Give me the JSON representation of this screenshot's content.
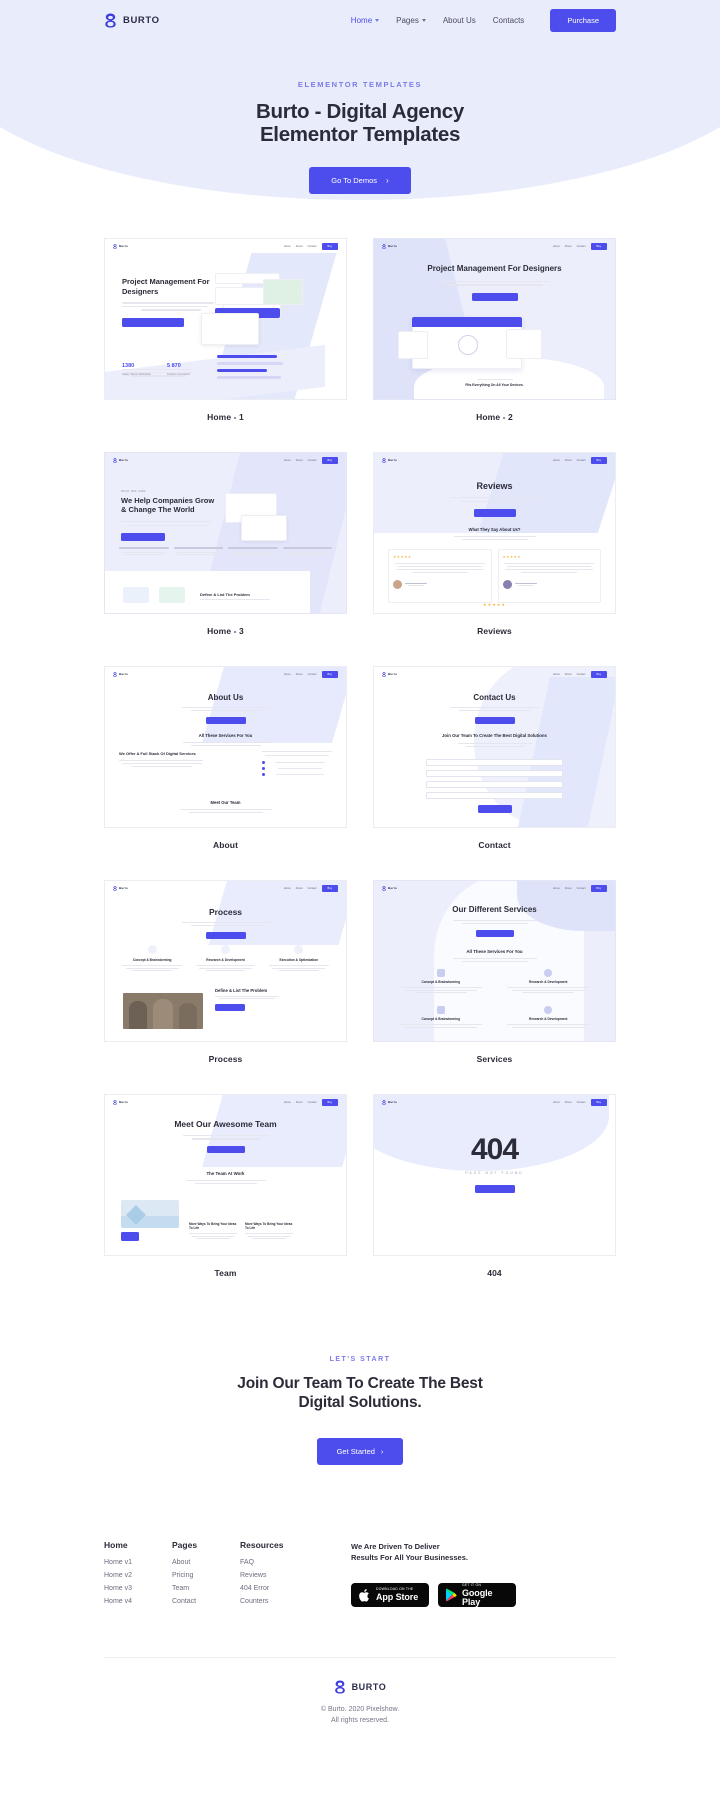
{
  "header": {
    "logo_text": "BURTO",
    "logo_icon": "burto-logo-icon",
    "nav": [
      {
        "label": "Home",
        "has_dropdown": true,
        "active": true
      },
      {
        "label": "Pages",
        "has_dropdown": true,
        "active": false
      },
      {
        "label": "About Us",
        "has_dropdown": false,
        "active": false
      },
      {
        "label": "Contacts",
        "has_dropdown": false,
        "active": false
      }
    ],
    "purchase_label": "Purchase"
  },
  "hero": {
    "eyebrow": "ELEMENTOR TEMPLATES",
    "title_line1": "Burto - Digital Agency",
    "title_line2": "Elementor Templates",
    "cta_label": "Go To Demos",
    "cta_arrow": "›"
  },
  "templates": [
    {
      "label": "Home - 1",
      "preview": {
        "style": "home1",
        "title": "Project Management For Designers",
        "button": "Read More About Us",
        "stat1_value": "1380",
        "stat1_label": "Happy Clients Worldwide",
        "stat2_value": "5 870",
        "stat2_label": "Projects Completed"
      }
    },
    {
      "label": "Home - 2",
      "preview": {
        "style": "home2",
        "title": "Project Management For Designers",
        "button": "Get Started Now",
        "caption": "Fits Everything On All Your Devices."
      }
    },
    {
      "label": "Home - 3",
      "preview": {
        "style": "home3",
        "title": "We Help Companies Grow & Change The World",
        "button": "Read More",
        "footer_title": "Define & List The Problem"
      }
    },
    {
      "label": "Reviews",
      "preview": {
        "style": "reviews",
        "title": "Reviews",
        "button": "Read More",
        "section_title": "What They Say About Us?"
      }
    },
    {
      "label": "About",
      "preview": {
        "style": "about",
        "title": "About Us",
        "button": "Read More",
        "section_title": "All These Services For You",
        "sub_title": "We Offer A Full Stack Of Digital Services",
        "team_title": "Meet Our Team"
      }
    },
    {
      "label": "Contact",
      "preview": {
        "style": "contact",
        "title": "Contact Us",
        "button": "Read More",
        "section_title": "Join Our Team To Create The Best Digital Solutions",
        "submit": "Send"
      }
    },
    {
      "label": "Process",
      "preview": {
        "style": "process",
        "title": "Process",
        "button": "Read More",
        "footer_title": "Define & List The Problem"
      }
    },
    {
      "label": "Services",
      "preview": {
        "style": "services",
        "title": "Our Different Services",
        "button": "Read More",
        "section_title": "All These Services For You"
      }
    },
    {
      "label": "Team",
      "preview": {
        "style": "team",
        "title": "Meet Our Awesome Team",
        "button": "Read More",
        "section_title": "The Team At Work"
      }
    },
    {
      "label": "404",
      "preview": {
        "style": "notfound",
        "code": "404",
        "caption": "PAGE NOT FOUND",
        "button": "Back To Home"
      }
    }
  ],
  "lets_start": {
    "eyebrow": "LET'S START",
    "title_line1": "Join Our Team To Create The Best",
    "title_line2": "Digital Solutions.",
    "cta_label": "Get Started",
    "cta_arrow": "›"
  },
  "footer": {
    "columns": [
      {
        "title": "Home",
        "links": [
          "Home v1",
          "Home v2",
          "Home v3",
          "Home v4"
        ]
      },
      {
        "title": "Pages",
        "links": [
          "About",
          "Pricing",
          "Team",
          "Contact"
        ]
      },
      {
        "title": "Resources",
        "links": [
          "FAQ",
          "Reviews",
          "404 Error",
          "Counters"
        ]
      }
    ],
    "tagline_line1": "We Are Driven To Deliver",
    "tagline_line2": "Results For All Your Businesses.",
    "badges": [
      {
        "small": "DOWNLOAD ON THE",
        "big": "App Store",
        "icon": "apple-icon"
      },
      {
        "small": "GET IT ON",
        "big": "Google Play",
        "icon": "google-play-icon"
      }
    ],
    "logo_text": "BURTO",
    "copyright_line1": "© Burto. 2020 Pixelshow.",
    "copyright_line2": "All rights reserved."
  },
  "colors": {
    "accent": "#4d4ded",
    "hero_bg": "#e9edfb",
    "text": "#2b2b39",
    "muted": "#6c6c80"
  }
}
